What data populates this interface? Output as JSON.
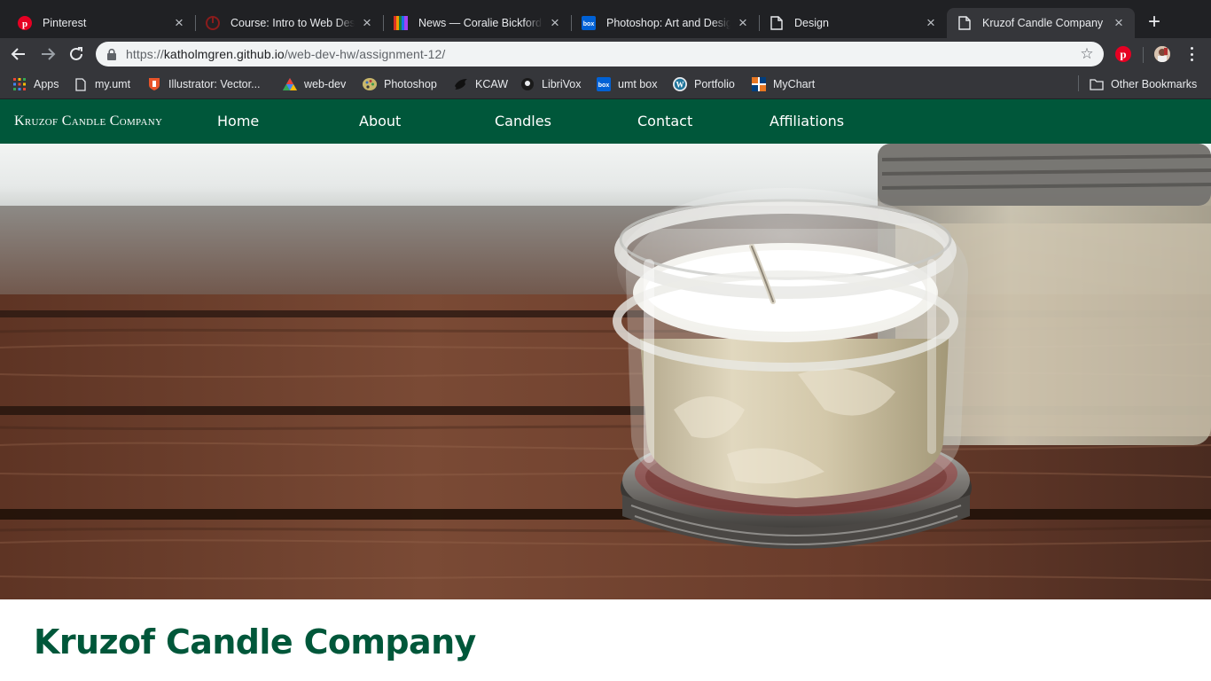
{
  "browser": {
    "tabs": [
      {
        "title": "Pinterest",
        "icon": "pinterest-icon",
        "active": false
      },
      {
        "title": "Course: Intro to Web Design",
        "icon": "course-icon",
        "active": false
      },
      {
        "title": "News — Coralie Bickford-Smith",
        "icon": "rainbow-stripes-icon",
        "active": false
      },
      {
        "title": "Photoshop: Art and Design",
        "icon": "box-icon",
        "active": false
      },
      {
        "title": "Design",
        "icon": "page-icon",
        "active": false
      },
      {
        "title": "Kruzof Candle Company",
        "icon": "page-icon",
        "active": true
      }
    ],
    "address": {
      "host": "katholmgren.github.io",
      "path": "/web-dev-hw/assignment-12/",
      "scheme": "https://"
    },
    "bookmarks": [
      {
        "label": "Apps",
        "icon": "apps-grid-icon"
      },
      {
        "label": "my.umt",
        "icon": "page-icon"
      },
      {
        "label": "Illustrator: Vector...",
        "icon": "shield-icon"
      },
      {
        "label": "web-dev",
        "icon": "triangle-logo-icon"
      },
      {
        "label": "Photoshop",
        "icon": "palette-icon"
      },
      {
        "label": "KCAW",
        "icon": "raven-icon"
      },
      {
        "label": "LibriVox",
        "icon": "librivox-icon"
      },
      {
        "label": "umt box",
        "icon": "box-icon"
      },
      {
        "label": "Portfolio",
        "icon": "wordpress-icon"
      },
      {
        "label": "MyChart",
        "icon": "mychart-icon"
      }
    ],
    "other_bookmarks": "Other Bookmarks"
  },
  "site": {
    "brand": "Kruzof Candle Company",
    "nav": [
      "Home",
      "About",
      "Candles",
      "Contact",
      "Affiliations"
    ],
    "heading": "Kruzof Candle Company"
  },
  "colors": {
    "brand_green": "#00573a",
    "chrome_dark": "#202124",
    "chrome_toolbar": "#35363a",
    "omnibox": "#f1f3f4"
  }
}
